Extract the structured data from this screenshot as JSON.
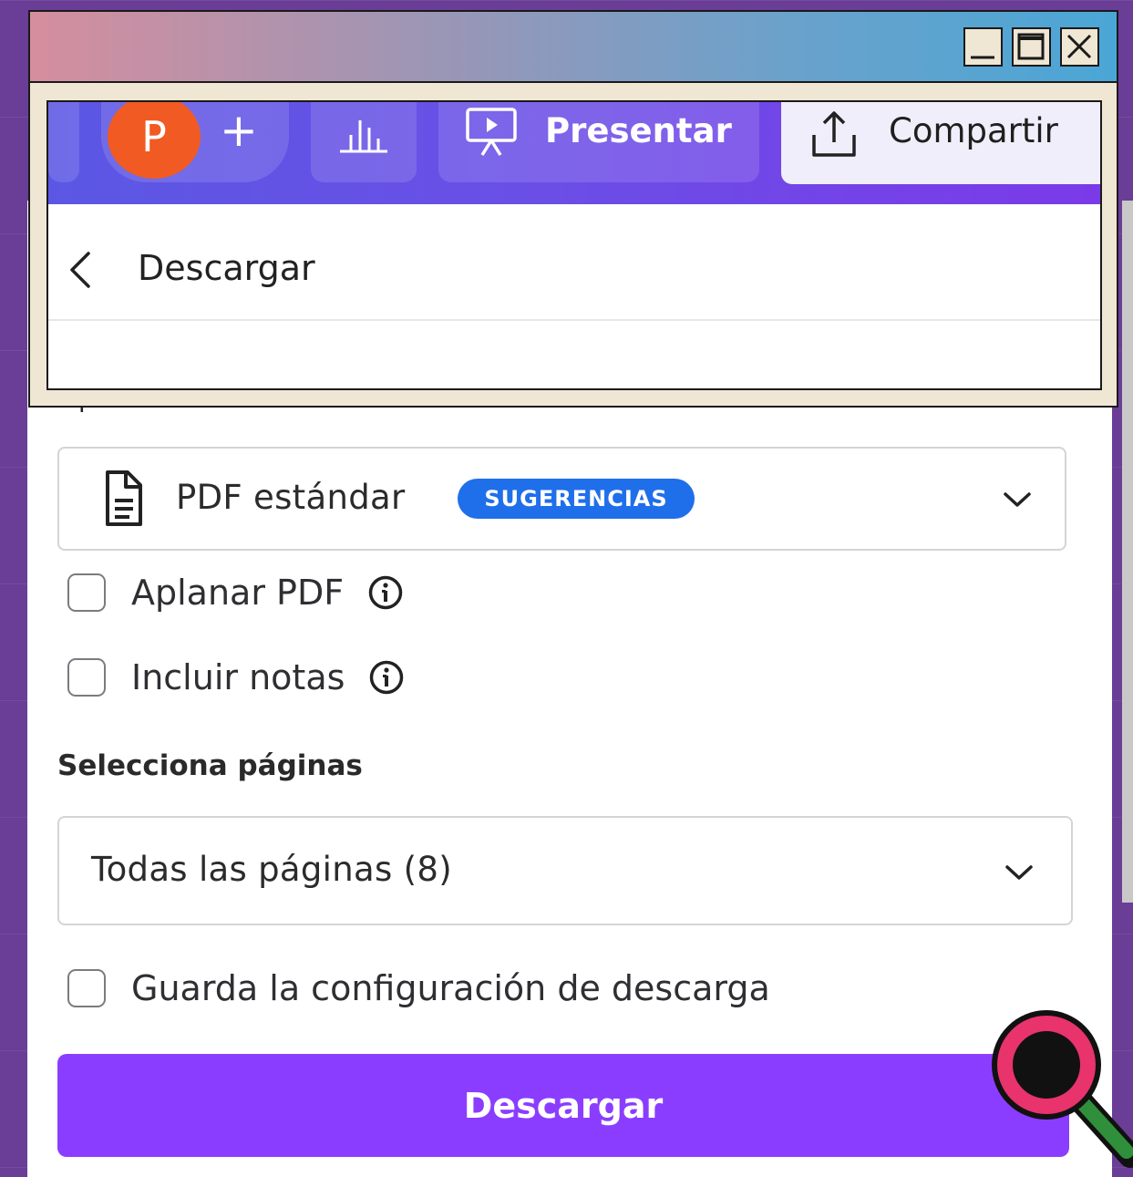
{
  "window": {
    "controls": [
      "minimize-icon",
      "maximize-icon",
      "close-icon"
    ]
  },
  "toolbar": {
    "avatar_initial": "P",
    "add_label": "+",
    "present_label": "Presentar",
    "share_label": "Compartir"
  },
  "panel": {
    "title": "Descargar",
    "file_type_label_partial": "Tipo de archivo",
    "file_type": {
      "value": "PDF estándar",
      "badge": "SUGERENCIAS"
    },
    "options": [
      {
        "label": "Aplanar PDF",
        "checked": false,
        "has_info": true
      },
      {
        "label": "Incluir notas",
        "checked": false,
        "has_info": true
      }
    ],
    "pages_label": "Selecciona páginas",
    "pages_value": "Todas las páginas (8)",
    "save_settings": {
      "label": "Guarda la configuración de descarga",
      "checked": false
    },
    "download_button": "Descargar"
  },
  "colors": {
    "background": "#6a3d96",
    "accent_purple": "#8b3dff",
    "badge_blue": "#1f6feb",
    "avatar_orange": "#f15a22",
    "magnifier_pink": "#e8336d"
  }
}
